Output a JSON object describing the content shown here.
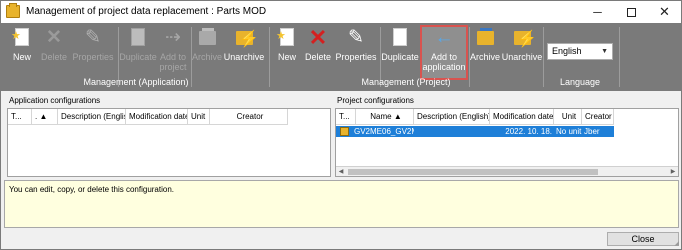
{
  "window": {
    "title": "Management of project data replacement : Parts MOD",
    "minimize_glyph": "─",
    "close_glyph": "✕"
  },
  "ribbon": {
    "application_group": {
      "label": "Management (Application)",
      "buttons": [
        {
          "label": "New",
          "enabled": true,
          "icon": "new-document-icon"
        },
        {
          "label": "Delete",
          "enabled": false,
          "icon": "delete-x-icon"
        },
        {
          "label": "Properties",
          "enabled": false,
          "icon": "properties-icon"
        },
        {
          "label": "Duplicate",
          "enabled": false,
          "icon": "duplicate-icon"
        },
        {
          "label": "Add to",
          "label2": "project",
          "enabled": false,
          "icon": "add-to-project-icon"
        },
        {
          "label": "Archive",
          "enabled": false,
          "icon": "archive-icon"
        },
        {
          "label": "Unarchive",
          "enabled": true,
          "icon": "unarchive-icon"
        }
      ]
    },
    "project_group": {
      "label": "Management (Project)",
      "buttons": [
        {
          "label": "New",
          "enabled": true,
          "icon": "new-document-icon"
        },
        {
          "label": "Delete",
          "enabled": true,
          "icon": "delete-x-icon"
        },
        {
          "label": "Properties",
          "enabled": true,
          "icon": "properties-icon"
        },
        {
          "label": "Duplicate",
          "enabled": true,
          "icon": "duplicate-icon"
        },
        {
          "label": "Add to",
          "label2": "application",
          "enabled": true,
          "highlighted": true,
          "icon": "arrow-left-icon"
        },
        {
          "label": "Archive",
          "enabled": true,
          "icon": "archive-icon"
        },
        {
          "label": "Unarchive",
          "enabled": true,
          "icon": "unarchive-icon"
        }
      ]
    },
    "language_group": {
      "label": "Language",
      "selected": "English"
    }
  },
  "application_configurations": {
    "title": "Application configurations",
    "columns": [
      "T...",
      ".",
      "Description (English)",
      "Modification date",
      "Unit",
      "Creator"
    ]
  },
  "project_configurations": {
    "title": "Project configurations",
    "columns": [
      "T...",
      "Name",
      "Description (English)",
      "Modification date",
      "Unit",
      "Creator"
    ],
    "rows": [
      {
        "name": "GV2ME06_GV2ME07",
        "description": "",
        "modification_date": "2022. 10. 18.",
        "unit": "No unit",
        "creator": "Jber"
      }
    ]
  },
  "message": "You can edit, copy, or delete this configuration.",
  "close_button": "Close",
  "colors": {
    "ribbon_bg": "#7a7a7a",
    "selection": "#1e7fd8",
    "highlight_border": "#d9534f",
    "message_bg": "#ffffdf"
  }
}
